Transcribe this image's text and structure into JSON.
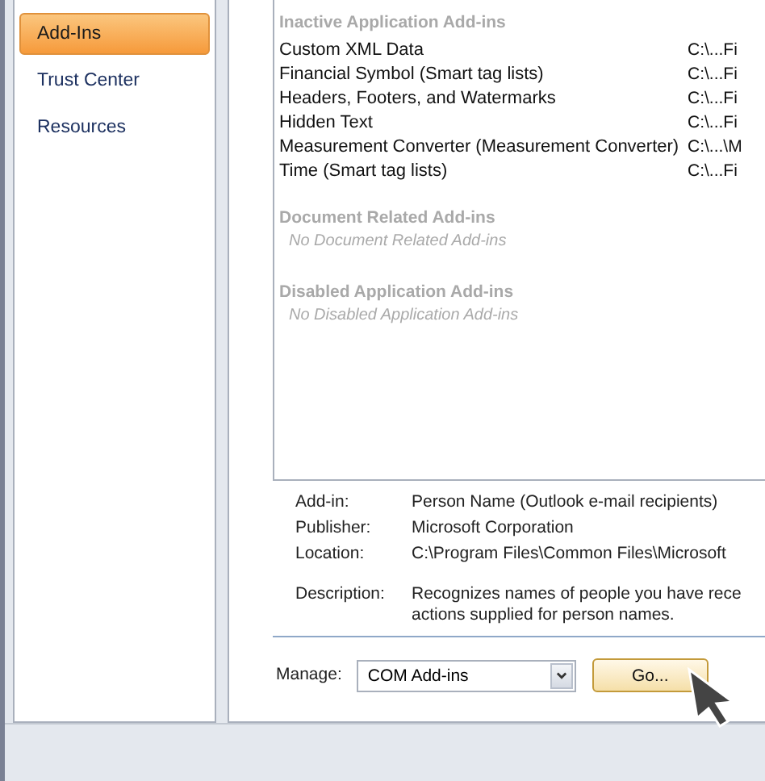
{
  "sidebar": {
    "items": [
      {
        "label": "Add-Ins",
        "selected": true
      },
      {
        "label": "Trust Center",
        "selected": false
      },
      {
        "label": "Resources",
        "selected": false
      }
    ]
  },
  "addins_list": {
    "groups": [
      {
        "title": "Inactive Application Add-ins",
        "rows": [
          {
            "name": "Custom XML Data",
            "location": "C:\\...Fi"
          },
          {
            "name": "Financial Symbol (Smart tag lists)",
            "location": "C:\\...Fi"
          },
          {
            "name": "Headers, Footers, and Watermarks",
            "location": "C:\\...Fi"
          },
          {
            "name": "Hidden Text",
            "location": "C:\\...Fi"
          },
          {
            "name": "Measurement Converter (Measurement Converter)",
            "location": "C:\\...\\M"
          },
          {
            "name": "Time (Smart tag lists)",
            "location": "C:\\...Fi"
          }
        ]
      },
      {
        "title": "Document Related Add-ins",
        "empty": "No Document Related Add-ins"
      },
      {
        "title": "Disabled Application Add-ins",
        "empty": "No Disabled Application Add-ins"
      }
    ]
  },
  "details": [
    {
      "label": "Add-in:",
      "lines": [
        "Person Name (Outlook e-mail recipients)"
      ]
    },
    {
      "label": "Publisher:",
      "lines": [
        "Microsoft Corporation"
      ]
    },
    {
      "label": "Location:",
      "lines": [
        "C:\\Program Files\\Common Files\\Microsoft"
      ]
    },
    {
      "label": "Description:",
      "lines": [
        "Recognizes names of people you have rece",
        "actions supplied for person names."
      ]
    }
  ],
  "manage": {
    "label": "Manage:",
    "value": "COM Add-ins",
    "button": "Go..."
  }
}
